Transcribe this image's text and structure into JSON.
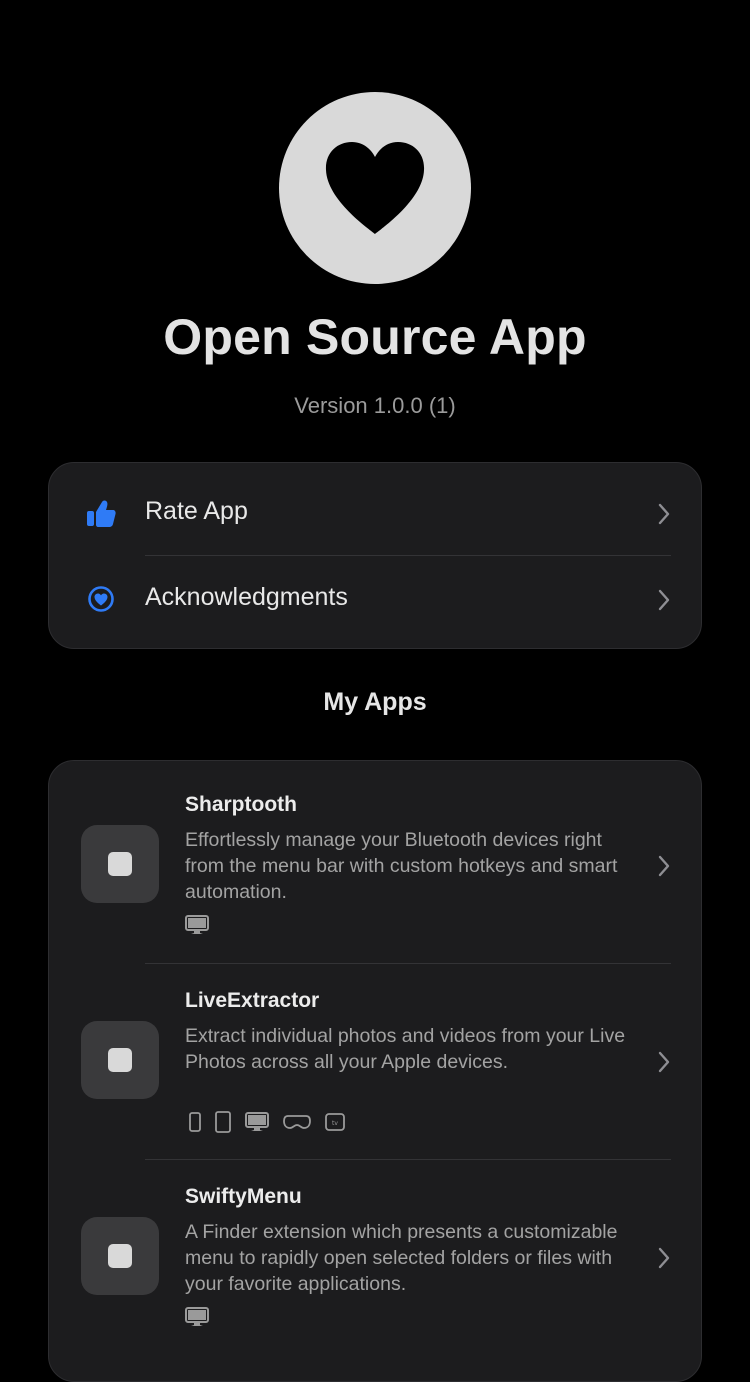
{
  "app": {
    "logo_icon": "heart-icon",
    "title": "Open Source App",
    "version": "Version 1.0.0 (1)"
  },
  "links": [
    {
      "label": "Rate App",
      "icon": "thumbs-up-icon",
      "icon_color": "#2f7bf6"
    },
    {
      "label": "Acknowledgments",
      "icon": "heart-circle-icon",
      "icon_color": "#2f7bf6"
    }
  ],
  "my_apps": {
    "title": "My Apps",
    "apps": [
      {
        "name": "Sharptooth",
        "description": "Effortlessly manage your Bluetooth devices right from the menu bar with custom hotkeys and smart automation.",
        "platforms": [
          "mac-icon"
        ]
      },
      {
        "name": "LiveExtractor",
        "description": "Extract individual photos and videos from your Live Photos across all your Apple devices.",
        "platforms": [
          "iphone-icon",
          "ipad-icon",
          "mac-icon",
          "vision-pro-icon",
          "apple-tv-icon"
        ]
      },
      {
        "name": "SwiftyMenu",
        "description": "A Finder extension which presents a customizable menu to rapidly open selected folders or files with your favorite applications.",
        "platforms": [
          "mac-icon"
        ]
      }
    ]
  },
  "colors": {
    "background": "#000000",
    "card": "#1c1c1e",
    "accent": "#2f7bf6"
  }
}
